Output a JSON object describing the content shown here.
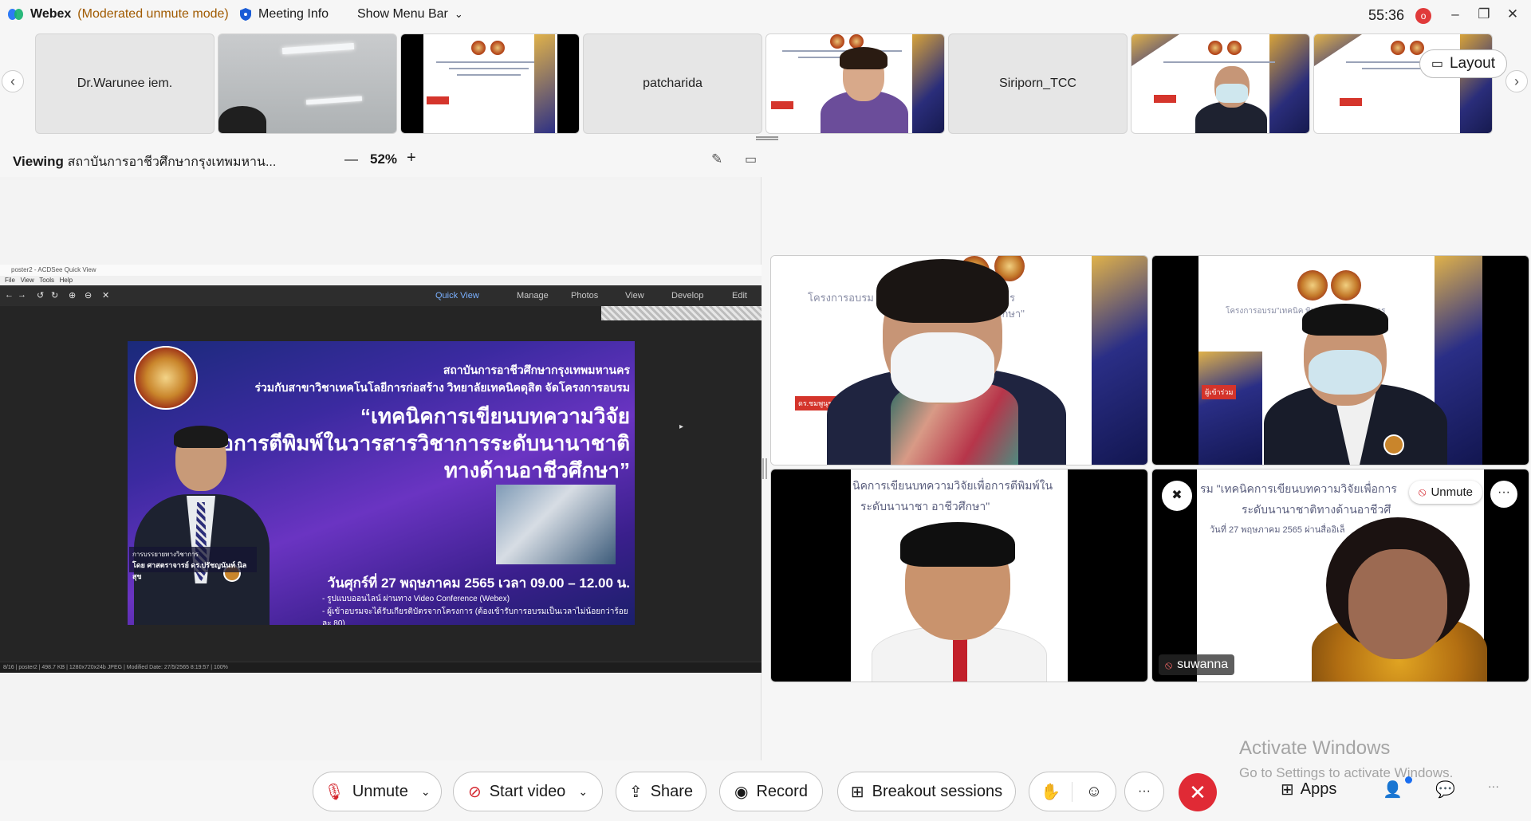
{
  "titlebar": {
    "app_name": "Webex",
    "mode": "(Moderated unmute mode)",
    "meeting_info": "Meeting Info",
    "show_menu_bar": "Show Menu Bar",
    "timer": "55:36",
    "rec_indicator": "o"
  },
  "filmstrip": {
    "participants": [
      {
        "name": "Dr.Warunee iem.",
        "kind": "name-only"
      },
      {
        "name": "",
        "kind": "ceiling"
      },
      {
        "name": "",
        "kind": "slide-black"
      },
      {
        "name": "patcharida",
        "kind": "name-only"
      },
      {
        "name": "",
        "kind": "slide-person"
      },
      {
        "name": "Siriporn_TCC",
        "kind": "name-only"
      },
      {
        "name": "",
        "kind": "slide-person-mask"
      },
      {
        "name": "",
        "kind": "slide"
      }
    ],
    "layout_label": "Layout"
  },
  "viewing": {
    "label": "Viewing",
    "source": "สถาบันการอาชีวศึกษากรุงเทพมหาน...",
    "zoom_minus": "—",
    "zoom_level": "52%",
    "zoom_plus": "+"
  },
  "acdsee": {
    "title": "poster2 - ACDSee Quick View",
    "menu": [
      "File",
      "View",
      "Tools",
      "Help"
    ],
    "modes": [
      "Quick View",
      "Manage",
      "Photos",
      "View",
      "Develop",
      "Edit"
    ],
    "status": "8/16 | poster2 | 498.7 KB | 1280x720x24b JPEG | Modified Date: 27/5/2565 8:19:57 | 100%"
  },
  "poster": {
    "org": "สถาบันการอาชีวศึกษากรุงเทพมหานคร",
    "cohost": "ร่วมกับสาขาวิชาเทคโนโลยีการก่อสร้าง  วิทยาลัยเทคนิคดุสิต  จัดโครงการอบรม",
    "title_1": "“เทคนิคการเขียนบทความวิจัย",
    "title_2": "เพื่อการตีพิมพ์ในวารสารวิชาการระดับนานาชาติ",
    "title_3": "ทางด้านอาชีวศึกษา”",
    "date": "วันศุกร์ที่ 27 พฤษภาคม 2565 เวลา 09.00 – 12.00 น.",
    "bullet_1": "- รูปแบบออนไลน์ ผ่านทาง Video Conference (Webex)",
    "bullet_2": "- ผู้เข้าอบรมจะได้รับเกียรติบัตรจากโครงการ (ต้องเข้ารับการอบรมเป็นเวลาไม่น้อยกว่าร้อยละ 80)",
    "speaker_role": "การบรรยายทางวิชาการ",
    "speaker_name": "โดย ศาสตราจารย์ ดร.ปรัชญนันท์ นิลสุข"
  },
  "tiles": {
    "t1_text": "โครงการอบรม \"เ  การตีพิมพ์ในวารสารวิชาการ",
    "t1_text2": "อาชีวศึกษา\"",
    "t1_tag": "ดร.ชมพูนุช นิ่งนัตร",
    "t2_text": "โครงการอบรม\"เทคนิค  พิมพ์ในวารสารวิชาการ",
    "t2_tag": "ผู้เข้าร่วม",
    "t3_text": "นิคการเขียนบทความวิจัยเพื่อการตีพิมพ์ใน",
    "t3_text2": "ระดับนานาชา  อาชีวศึกษา\"",
    "t4_text": "รม \"เทคนิคการเขียนบทความวิจัยเพื่อการ",
    "t4_text2": "ระดับนานาชาติทางด้านอาชีวศึ",
    "t4_text3": "วันที่ 27 พฤษภาคม 2565 ผ่านสื่ออิเล็",
    "t4_name": "suwanna",
    "t4_unmute": "Unmute"
  },
  "watermark": {
    "line1": "Activate Windows",
    "line2": "Go to Settings to activate Windows."
  },
  "controls": {
    "unmute": "Unmute",
    "start_video": "Start video",
    "share": "Share",
    "record": "Record",
    "breakout": "Breakout sessions",
    "more": "···",
    "apps": "Apps"
  },
  "colors": {
    "accent_red": "#e02a35",
    "mode_text": "#a05a00"
  }
}
